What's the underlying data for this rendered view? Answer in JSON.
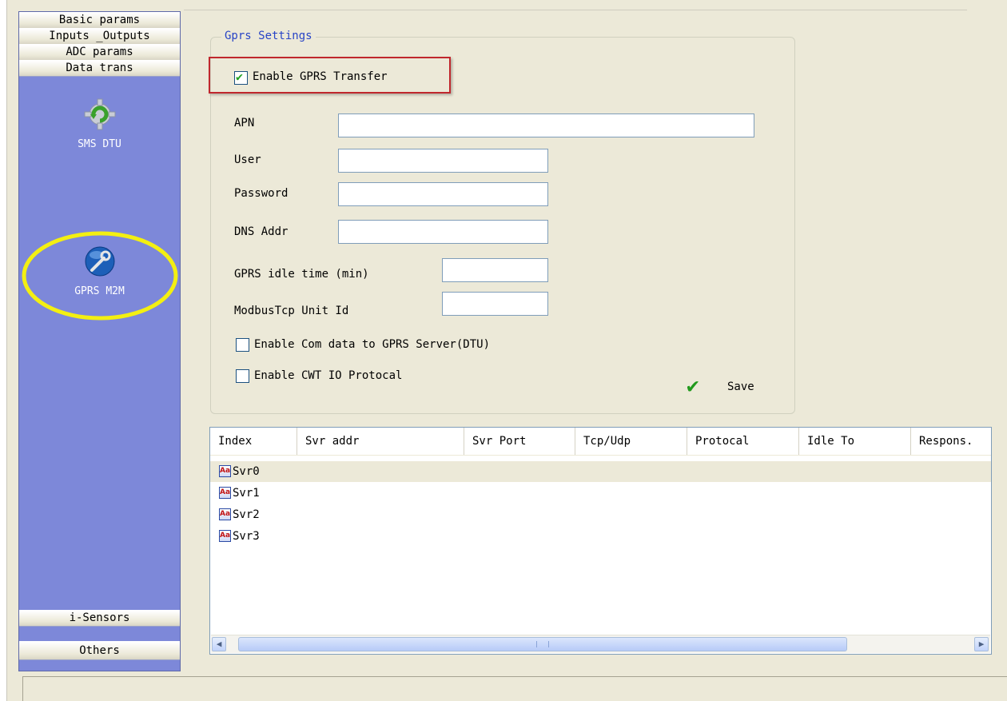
{
  "sidebar": {
    "top_items": [
      "Basic params",
      "Inputs _Outputs",
      "ADC params",
      "Data trans"
    ],
    "tools": [
      {
        "label": "SMS DTU",
        "icon": "gear-refresh-icon"
      },
      {
        "label": "GPRS M2M",
        "icon": "wrench-globe-icon"
      }
    ],
    "bottom_items": [
      "i-Sensors",
      "Others"
    ]
  },
  "gprs": {
    "title": "Gprs Settings",
    "enable_label": "Enable GPRS Transfer",
    "enable_checked": true,
    "apn_label": "APN",
    "apn_value": "",
    "user_label": "User",
    "user_value": "",
    "password_label": "Password",
    "password_value": "",
    "dns_label": "DNS Addr",
    "dns_value": "",
    "idle_label": "GPRS idle time (min)",
    "idle_value": "",
    "unitid_label": "ModbusTcp Unit Id",
    "unitid_value": "",
    "com_label": "Enable Com data to GPRS Server(DTU)",
    "com_checked": false,
    "cwt_label": "Enable CWT IO Protocal",
    "cwt_checked": false,
    "save_label": "Save"
  },
  "servers": {
    "columns": [
      "Index",
      "Svr addr",
      "Svr Port",
      "Tcp/Udp",
      "Protocal",
      "Idle To",
      "Respons."
    ],
    "rows": [
      "Svr0",
      "Svr1",
      "Svr2",
      "Svr3"
    ],
    "row_icon_text": "Aa"
  },
  "colors": {
    "sidebar_bg": "#7d88d9",
    "group_title": "#2844c6",
    "highlight": "#c0272d",
    "check": "#21a121"
  }
}
